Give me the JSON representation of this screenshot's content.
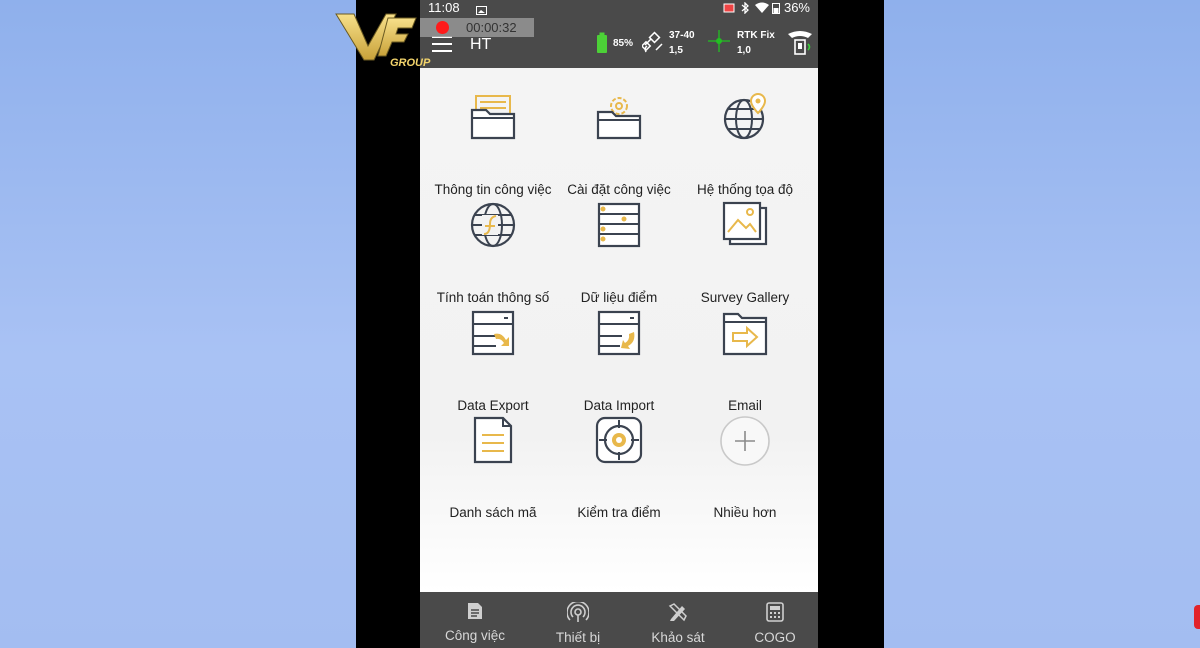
{
  "logo": {
    "brand": "VF",
    "sub": "GROUP"
  },
  "status_bar": {
    "time": "11:08",
    "battery": "36%"
  },
  "recorder": {
    "elapsed": "00:00:32"
  },
  "app_bar": {
    "title": "HT",
    "device_battery": "85%",
    "satellites": "37-40",
    "satellites_sub": "1,5",
    "rtk_status": "RTK Fix",
    "rtk_sub": "1,0"
  },
  "grid": [
    {
      "label": "Thông tin công việc",
      "icon": "job-info-folder-icon"
    },
    {
      "label": "Cài đặt công việc",
      "icon": "job-settings-folder-icon"
    },
    {
      "label": "Hệ thống tọa độ",
      "icon": "globe-pin-icon"
    },
    {
      "label": "Tính toán thông số",
      "icon": "globe-calc-icon"
    },
    {
      "label": "Dữ liệu điểm",
      "icon": "point-data-icon"
    },
    {
      "label": "Survey Gallery",
      "icon": "gallery-icon"
    },
    {
      "label": "Data Export",
      "icon": "data-export-icon"
    },
    {
      "label": "Data Import",
      "icon": "data-import-icon"
    },
    {
      "label": "Email",
      "icon": "email-folder-icon"
    },
    {
      "label": "Danh sách mã",
      "icon": "code-list-icon"
    },
    {
      "label": "Kiểm tra điểm",
      "icon": "target-icon"
    },
    {
      "label": "Nhiều hơn",
      "icon": "plus-circle-icon"
    }
  ],
  "bottom_nav": [
    {
      "label": "Công việc",
      "icon": "document-icon"
    },
    {
      "label": "Thiết bị",
      "icon": "antenna-icon"
    },
    {
      "label": "Khảo sát",
      "icon": "survey-pen-icon"
    },
    {
      "label": "COGO",
      "icon": "calculator-icon"
    }
  ]
}
